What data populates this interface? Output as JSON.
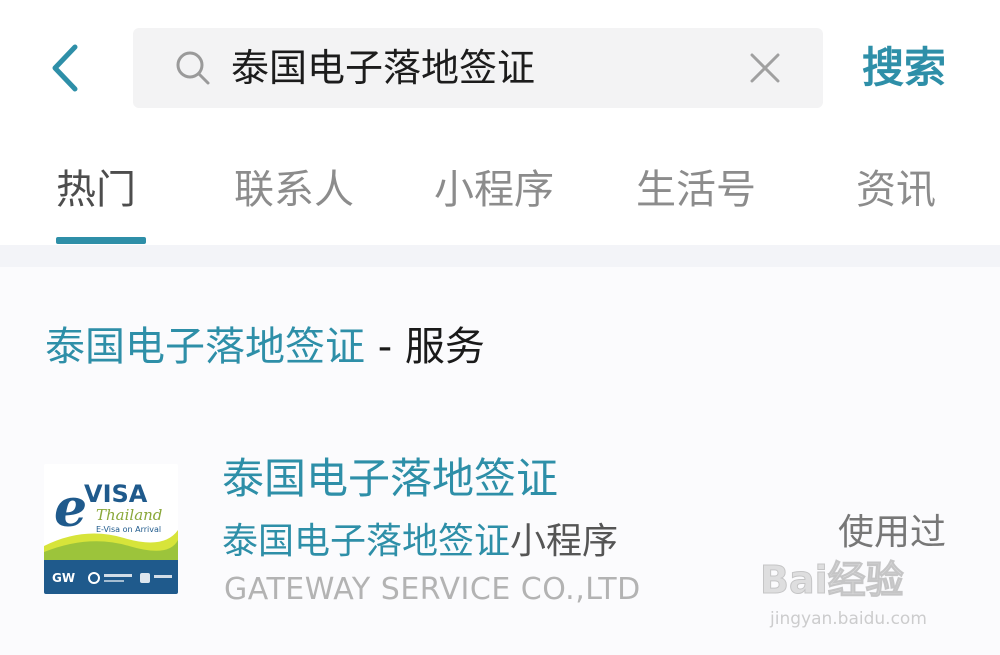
{
  "colors": {
    "accent": "#2e8fa8",
    "text_primary": "#1a1a1a",
    "text_muted": "#8c8c8c",
    "search_bg": "#f3f3f4"
  },
  "header": {
    "back_icon": "chevron-left-icon",
    "search": {
      "value": "泰国电子落地签证",
      "search_icon": "search-icon",
      "clear_icon": "close-icon"
    },
    "search_button_label": "搜索"
  },
  "tabs": [
    {
      "label": "热门",
      "active": true
    },
    {
      "label": "联系人",
      "active": false
    },
    {
      "label": "小程序",
      "active": false
    },
    {
      "label": "生活号",
      "active": false
    },
    {
      "label": "资讯",
      "active": false
    }
  ],
  "section": {
    "title_highlight": "泰国电子落地签证",
    "title_rest": " - 服务"
  },
  "result": {
    "title": "泰国电子落地签证",
    "subtitle_highlight": "泰国电子落地签证",
    "subtitle_rest": "小程序",
    "company": "GATEWAY SERVICE CO.,LTD",
    "badge": "使用过",
    "logo": {
      "brand_e": "e",
      "brand_visa": "VISA",
      "brand_country": "Thailand",
      "tagline": "E-Visa on Arrival",
      "footer_left": "GW"
    }
  },
  "watermark": {
    "brand": "Bai经验",
    "url": "jingyan.baidu.com"
  }
}
